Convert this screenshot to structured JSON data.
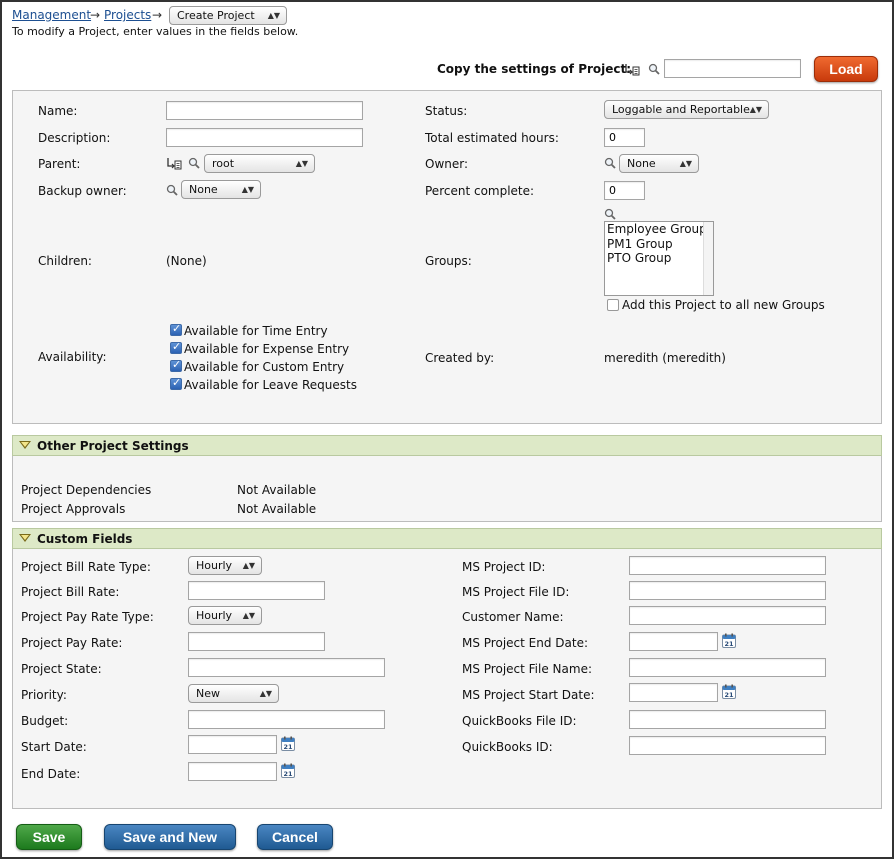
{
  "breadcrumb": {
    "management": "Management",
    "projects": "Projects",
    "arrow": "→",
    "current_select": "Create Project"
  },
  "instructions": "To modify a Project, enter values in the fields below.",
  "copy": {
    "label": "Copy the settings of Project:",
    "value": "",
    "load_label": "Load"
  },
  "main": {
    "name_label": "Name:",
    "description_label": "Description:",
    "parent_label": "Parent:",
    "parent_value": "root",
    "backup_owner_label": "Backup owner:",
    "backup_owner_value": "None",
    "children_label": "Children:",
    "children_value": "(None)",
    "availability_label": "Availability:",
    "availability": [
      {
        "label": "Available for Time Entry",
        "checked": true
      },
      {
        "label": "Available for Expense Entry",
        "checked": true
      },
      {
        "label": "Available for Custom Entry",
        "checked": true
      },
      {
        "label": "Available for Leave Requests",
        "checked": true
      }
    ],
    "status_label": "Status:",
    "status_value": "Loggable and Reportable",
    "total_hours_label": "Total estimated hours:",
    "total_hours_value": "0",
    "owner_label": "Owner:",
    "owner_value": "None",
    "percent_label": "Percent complete:",
    "percent_value": "0",
    "groups_label": "Groups:",
    "groups": [
      "Employee Group",
      "PM1 Group",
      "PTO Group"
    ],
    "add_groups_label": "Add this Project to all new Groups",
    "created_by_label": "Created by:",
    "created_by_value": "meredith (meredith)"
  },
  "other_settings": {
    "title": "Other Project Settings",
    "dependencies_label": "Project Dependencies",
    "dependencies_value": "Not Available",
    "approvals_label": "Project Approvals",
    "approvals_value": "Not Available"
  },
  "custom_fields": {
    "title": "Custom Fields",
    "bill_rate_type_label": "Project Bill Rate Type:",
    "bill_rate_type_value": "Hourly",
    "bill_rate_label": "Project Bill Rate:",
    "pay_rate_type_label": "Project Pay Rate Type:",
    "pay_rate_type_value": "Hourly",
    "pay_rate_label": "Project Pay Rate:",
    "state_label": "Project State:",
    "priority_label": "Priority:",
    "priority_value": "New",
    "budget_label": "Budget:",
    "start_date_label": "Start Date:",
    "end_date_label": "End Date:",
    "ms_project_id_label": "MS Project ID:",
    "ms_project_file_id_label": "MS Project File ID:",
    "customer_name_label": "Customer Name:",
    "ms_end_date_label": "MS Project End Date:",
    "ms_file_name_label": "MS Project File Name:",
    "ms_start_date_label": "MS Project Start Date:",
    "qb_file_id_label": "QuickBooks File ID:",
    "qb_id_label": "QuickBooks ID:",
    "calendar_day": "21"
  },
  "actions": {
    "save_label": "Save",
    "save_new_label": "Save and New",
    "cancel_label": "Cancel"
  },
  "icons": {
    "search": "magnifier-icon",
    "hierarchy": "hierarchy-icon",
    "calendar": "calendar-icon",
    "collapse": "triangle-down-icon"
  },
  "colors": {
    "section_header": "#dde9c7",
    "load_button": "#e0521c",
    "save_button": "#2f8f2f",
    "blue_button": "#2f6ba8"
  }
}
